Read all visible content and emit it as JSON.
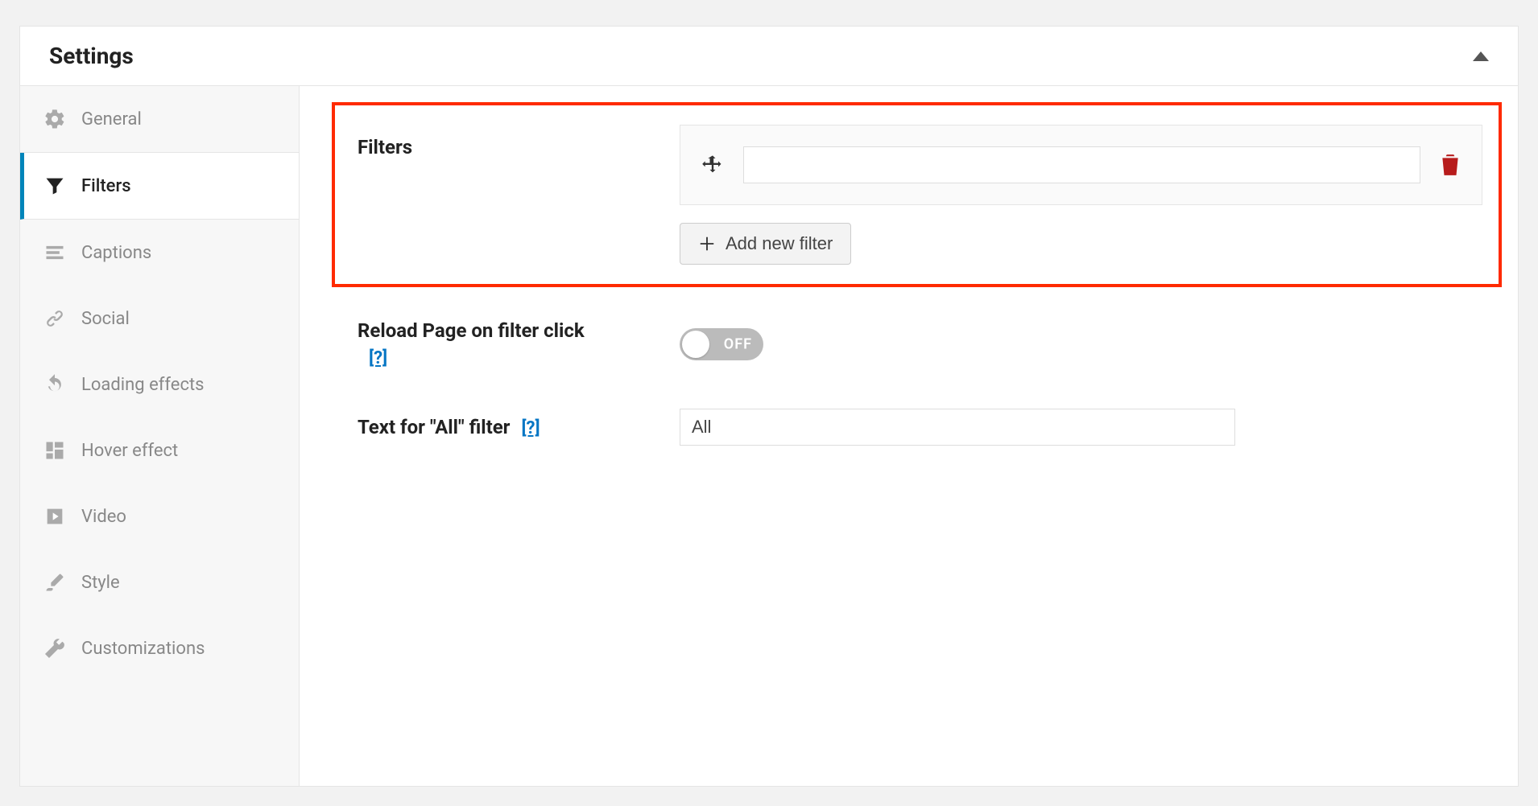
{
  "header": {
    "title": "Settings"
  },
  "sidebar": {
    "items": [
      {
        "label": "General"
      },
      {
        "label": "Filters"
      },
      {
        "label": "Captions"
      },
      {
        "label": "Social"
      },
      {
        "label": "Loading effects"
      },
      {
        "label": "Hover effect"
      },
      {
        "label": "Video"
      },
      {
        "label": "Style"
      },
      {
        "label": "Customizations"
      }
    ]
  },
  "filters_section": {
    "label": "Filters",
    "filter_rows": [
      {
        "value": ""
      }
    ],
    "add_button_label": "Add new filter"
  },
  "reload_section": {
    "label": "Reload Page on filter click",
    "help": "[?]",
    "toggle_state_label": "OFF"
  },
  "all_text_section": {
    "label": "Text for \"All\" filter",
    "help": "[?]",
    "value": "All"
  }
}
